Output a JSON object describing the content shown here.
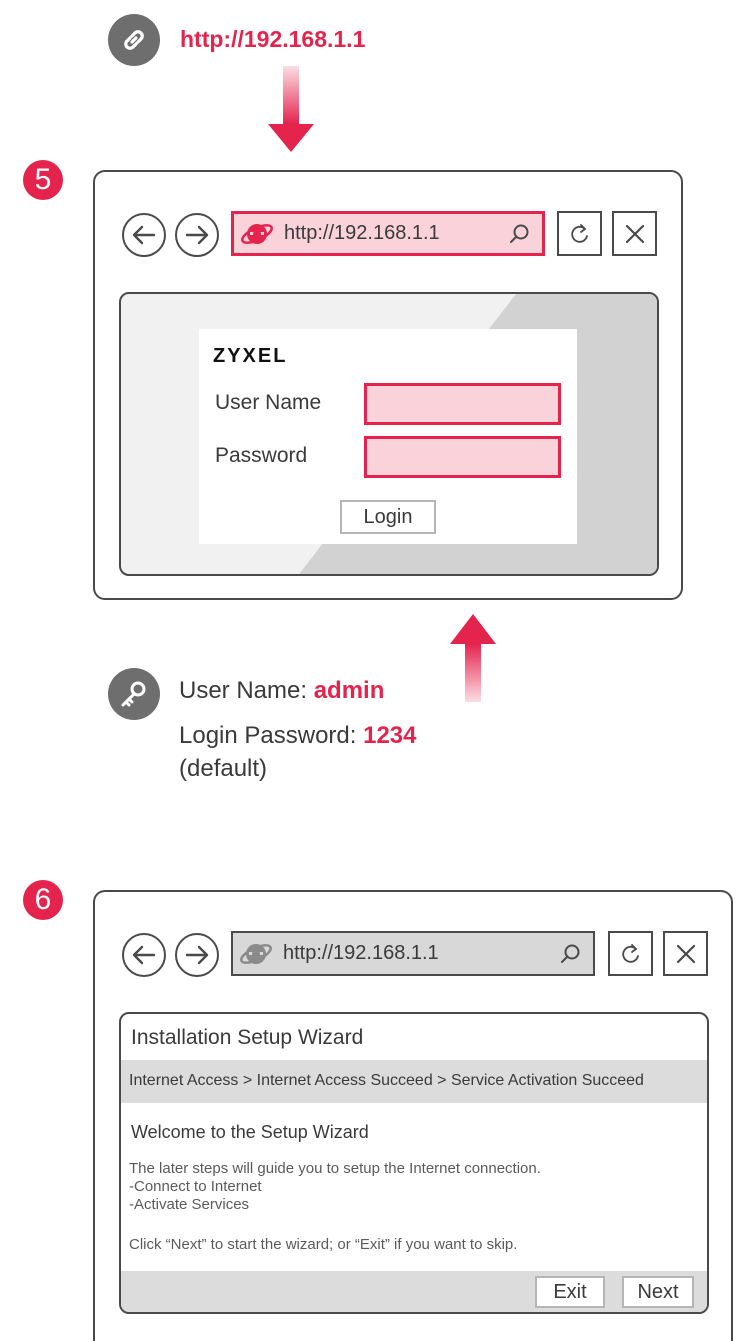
{
  "top": {
    "url": "http://192.168.1.1"
  },
  "step5": {
    "badge": "5",
    "address": "http://192.168.1.1",
    "login": {
      "logo": "ZYXEL",
      "user_label": "User Name",
      "password_label": "Password",
      "login_button": "Login"
    }
  },
  "credentials": {
    "user_prefix": "User Name: ",
    "user_value": "admin",
    "password_prefix": "Login Password: ",
    "password_value": "1234",
    "default_note": "(default)"
  },
  "step6": {
    "badge": "6",
    "address": "http://192.168.1.1",
    "wizard": {
      "title": "Installation Setup Wizard",
      "breadcrumb": "Internet Access > Internet Access Succeed > Service Activation Succeed",
      "welcome": "Welcome to the Setup Wizard",
      "line1": "The later steps will guide you to setup the Internet connection.",
      "line2": "-Connect to Internet",
      "line3": "-Activate Services",
      "instruction": "Click “Next” to start the wizard; or “Exit” if you want to skip.",
      "exit_button": "Exit",
      "next_button": "Next"
    }
  },
  "colors": {
    "accent": "#e5244e",
    "icon_gray": "#6e6e6e",
    "pink_fill": "#f9d2da"
  },
  "icons": [
    "link-icon",
    "arrow-down-icon",
    "back-arrow-icon",
    "forward-arrow-icon",
    "ie-icon",
    "search-icon",
    "refresh-icon",
    "close-icon",
    "key-icon",
    "arrow-up-icon"
  ]
}
